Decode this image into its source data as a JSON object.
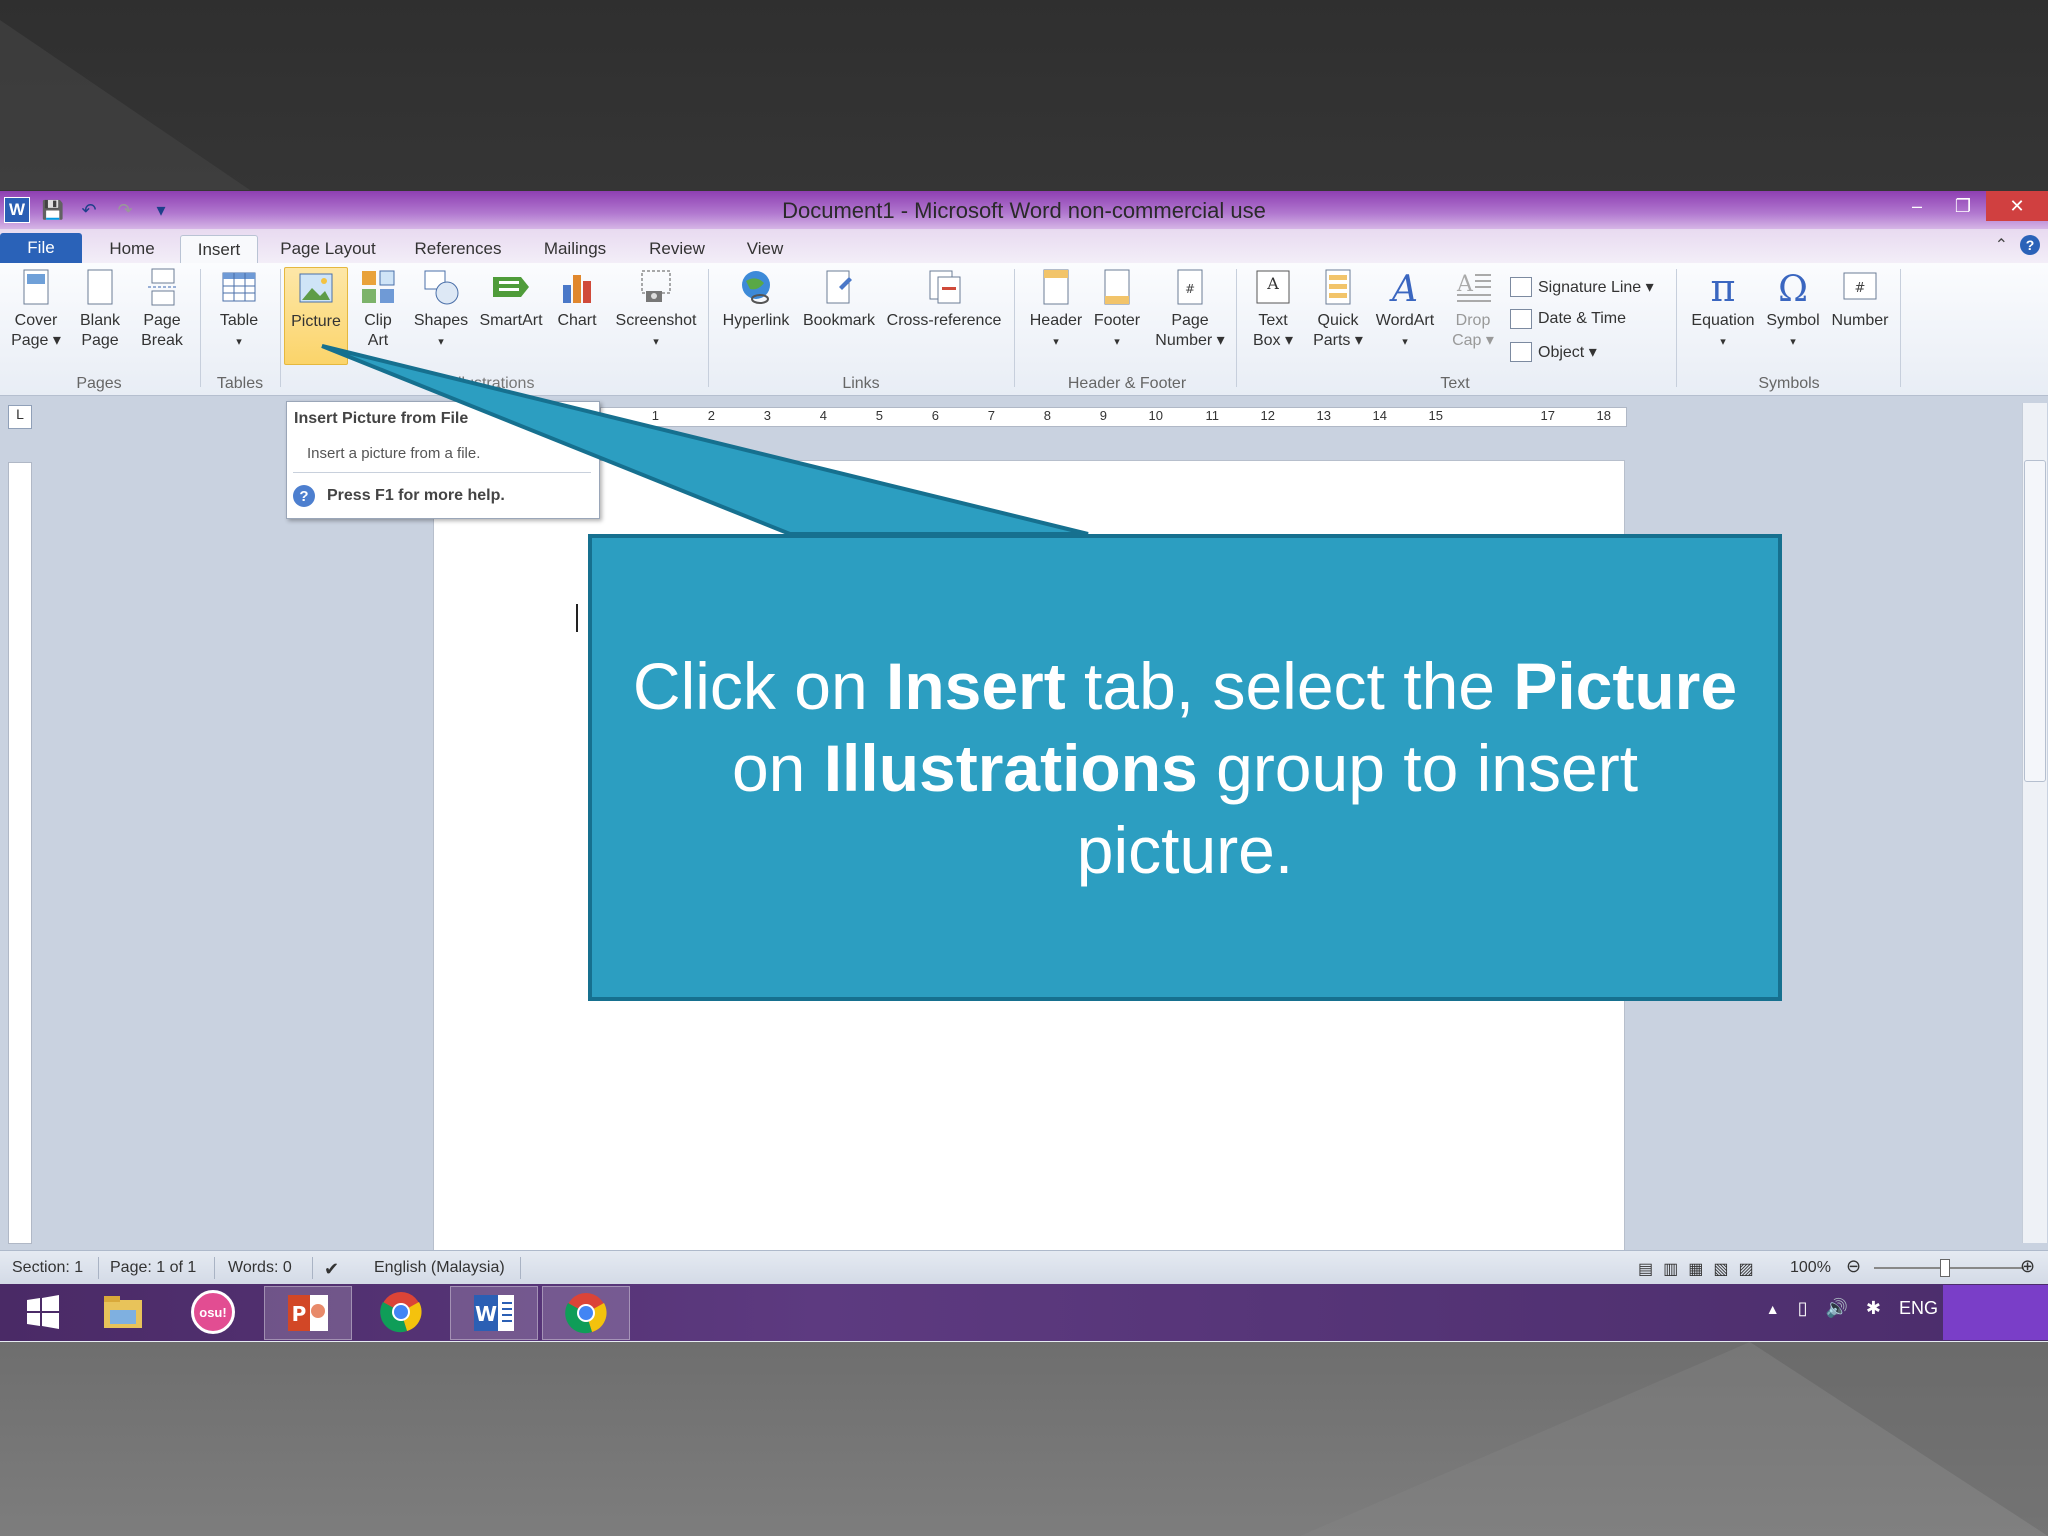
{
  "window": {
    "title": "Document1  -  Microsoft Word non-commercial use",
    "app_icon": "W"
  },
  "tabs": [
    {
      "label": "File"
    },
    {
      "label": "Home"
    },
    {
      "label": "Insert",
      "active": true
    },
    {
      "label": "Page Layout"
    },
    {
      "label": "References"
    },
    {
      "label": "Mailings"
    },
    {
      "label": "Review"
    },
    {
      "label": "View"
    }
  ],
  "ribbon": {
    "pages": {
      "cover_page": "Cover\nPage ▾",
      "blank_page": "Blank\nPage",
      "page_break": "Page\nBreak",
      "label": "Pages"
    },
    "tables": {
      "table": "Table",
      "label": "Tables"
    },
    "illustrations": {
      "picture": "Picture",
      "clip_art": "Clip\nArt",
      "shapes": "Shapes",
      "smartart": "SmartArt",
      "chart": "Chart",
      "screenshot": "Screenshot",
      "label": "Illustrations"
    },
    "links": {
      "hyperlink": "Hyperlink",
      "bookmark": "Bookmark",
      "cross_reference": "Cross-reference",
      "label": "Links"
    },
    "header_footer": {
      "header": "Header",
      "footer": "Footer",
      "page_number": "Page\nNumber ▾",
      "label": "Header & Footer"
    },
    "text": {
      "text_box": "Text\nBox ▾",
      "quick_parts": "Quick\nParts ▾",
      "wordart": "WordArt",
      "drop_cap": "Drop\nCap ▾",
      "signature_line": "Signature Line ▾",
      "date_time": "Date & Time",
      "object": "Object ▾",
      "label": "Text"
    },
    "symbols": {
      "equation": "Equation",
      "symbol": "Symbol",
      "number": "Number",
      "label": "Symbols"
    }
  },
  "tooltip": {
    "title": "Insert Picture from File",
    "description": "Insert a picture from a file.",
    "help": "Press F1 for more help."
  },
  "ruler": {
    "h_numbers": [
      "1",
      "2",
      "3",
      "4",
      "5",
      "6",
      "7",
      "8",
      "9",
      "10",
      "11",
      "12",
      "13",
      "14",
      "15",
      "",
      "17",
      "18"
    ],
    "corner": "L"
  },
  "status": {
    "section": "Section: 1",
    "page": "Page: 1 of 1",
    "words": "Words: 0",
    "language": "English (Malaysia)",
    "zoom": "100%"
  },
  "taskbar": {
    "apps": [
      "windows-start",
      "file-explorer",
      "osu",
      "powerpoint",
      "chrome",
      "word",
      "chrome"
    ],
    "osu_label": "osu!",
    "tray_language": "ENG"
  },
  "callout": {
    "parts": [
      {
        "text": "Click on ",
        "bold": false
      },
      {
        "text": "Insert",
        "bold": true
      },
      {
        "text": " tab, select the ",
        "bold": false
      },
      {
        "text": "Picture",
        "bold": true
      },
      {
        "text": " on ",
        "bold": false
      },
      {
        "text": "Illustrations",
        "bold": true
      },
      {
        "text": " group to insert picture.",
        "bold": false
      }
    ],
    "color": "#2c9ec1",
    "border_color": "#16708f"
  },
  "colors": {
    "title_gradient": "#8e3fb2",
    "file_tab": "#2a62b8",
    "picture_highlight": "#fbd46a",
    "taskbar": "#4a2a66"
  }
}
